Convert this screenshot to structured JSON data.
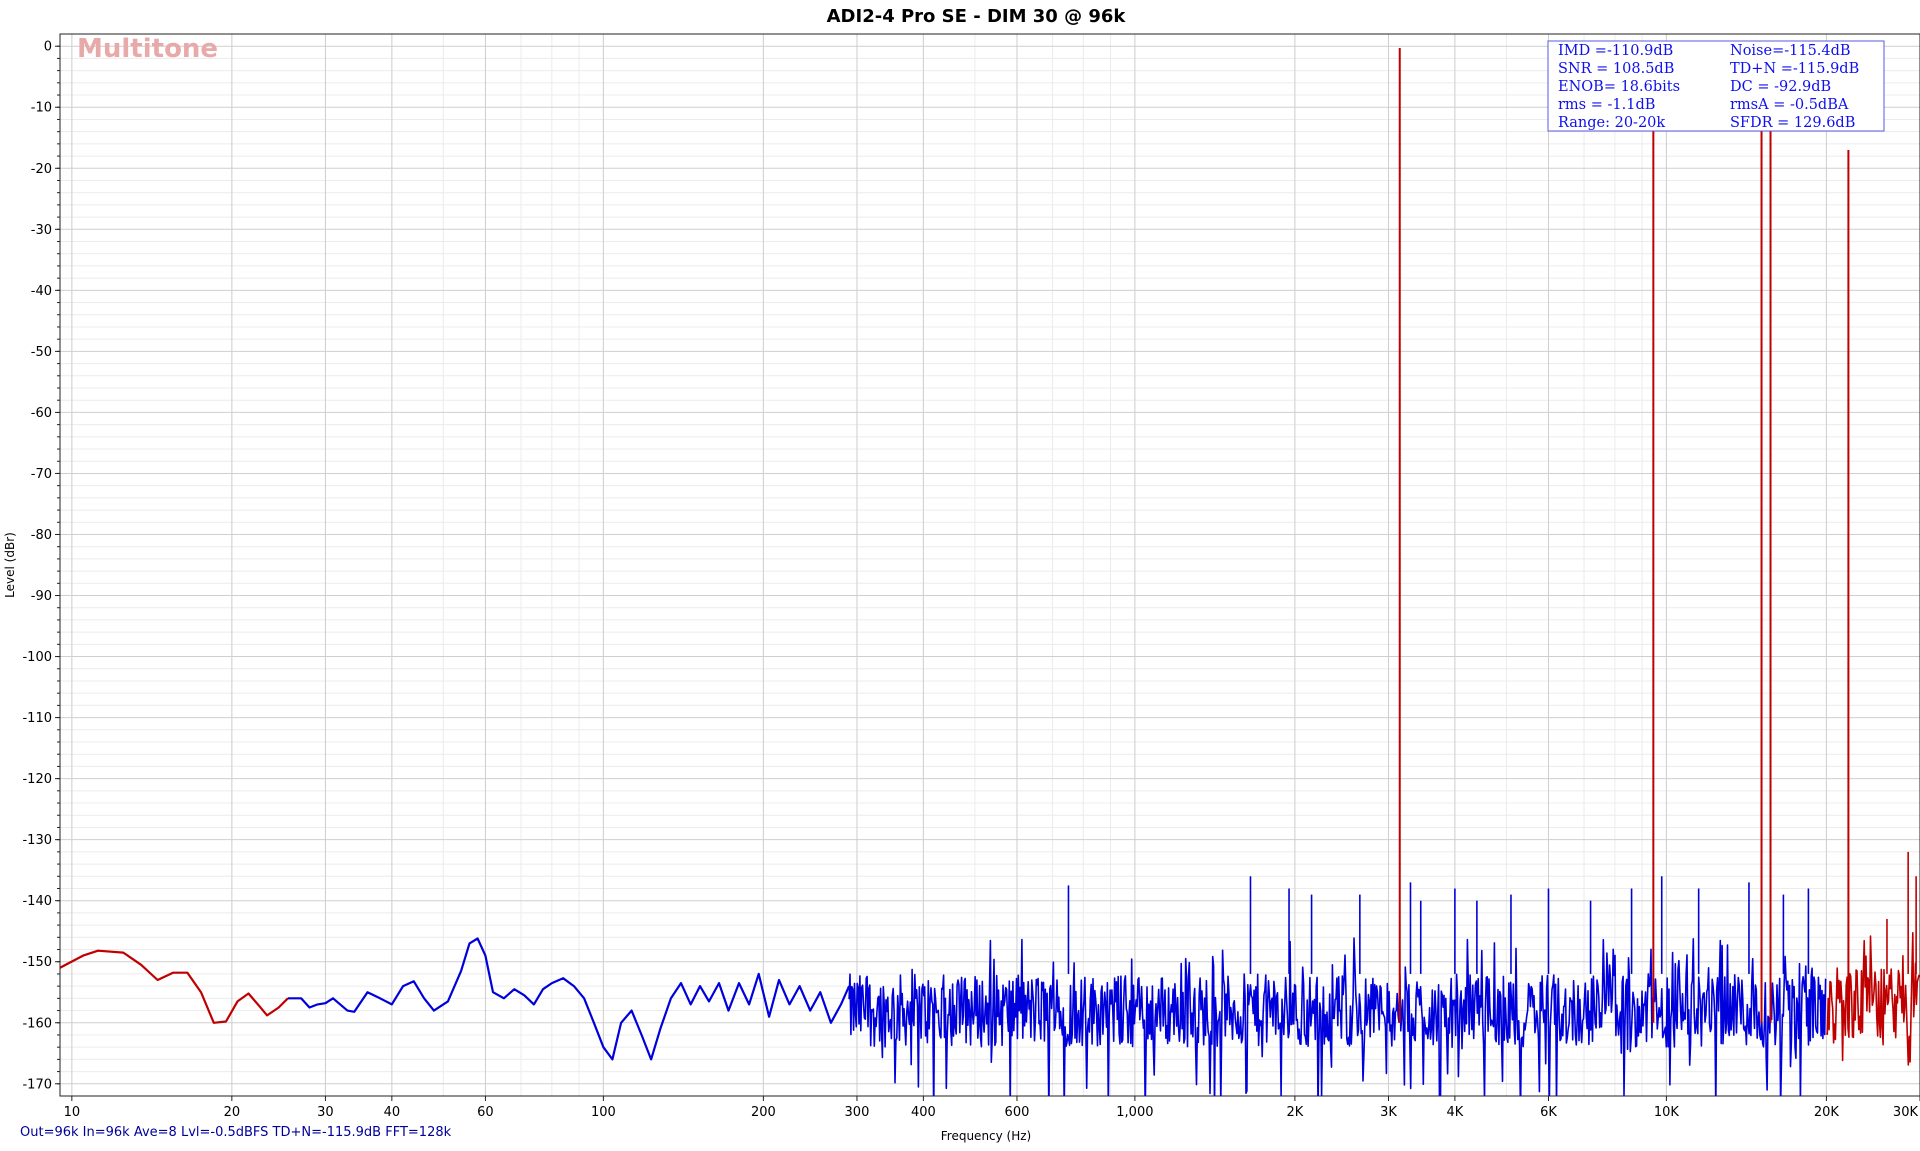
{
  "chart_data": {
    "type": "line",
    "title": "ADI2-4 Pro SE - DIM 30 @ 96k",
    "xlabel": "Frequency (Hz)",
    "ylabel": "Level (dBr)",
    "x_scale": "log",
    "xlim": [
      9.5,
      30000
    ],
    "ylim": [
      -172,
      2
    ],
    "grid": true,
    "x_ticks": [
      {
        "value": 10,
        "label": "10"
      },
      {
        "value": 20,
        "label": "20"
      },
      {
        "value": 30,
        "label": "30"
      },
      {
        "value": 40,
        "label": "40"
      },
      {
        "value": 60,
        "label": "60"
      },
      {
        "value": 100,
        "label": "100"
      },
      {
        "value": 200,
        "label": "200"
      },
      {
        "value": 300,
        "label": "300"
      },
      {
        "value": 400,
        "label": "400"
      },
      {
        "value": 600,
        "label": "600"
      },
      {
        "value": 1000,
        "label": "1,000"
      },
      {
        "value": 2000,
        "label": "2K"
      },
      {
        "value": 3000,
        "label": "3K"
      },
      {
        "value": 4000,
        "label": "4K"
      },
      {
        "value": 6000,
        "label": "6K"
      },
      {
        "value": 10000,
        "label": "10K"
      },
      {
        "value": 20000,
        "label": "20K"
      },
      {
        "value": 30000,
        "label": "30K"
      }
    ],
    "y_ticks": [
      0,
      -10,
      -20,
      -30,
      -40,
      -50,
      -60,
      -70,
      -80,
      -90,
      -100,
      -110,
      -120,
      -130,
      -140,
      -150,
      -160,
      -170
    ],
    "series": [
      {
        "color": "#c00000",
        "description": "low-band noise below 20 Hz",
        "points": [
          [
            9.5,
            -151
          ],
          [
            10.5,
            -149
          ],
          [
            11.2,
            -148.2
          ],
          [
            12.5,
            -148.5
          ],
          [
            13.5,
            -150.5
          ],
          [
            14.5,
            -153
          ],
          [
            15.5,
            -151.8
          ],
          [
            16.5,
            -151.8
          ],
          [
            17.5,
            -155
          ],
          [
            18.5,
            -160
          ],
          [
            19.5,
            -159.8
          ],
          [
            20.5,
            -156.5
          ],
          [
            21.5,
            -155.2
          ],
          [
            22.5,
            -157.2
          ],
          [
            23.3,
            -158.8
          ],
          [
            24.5,
            -157.5
          ],
          [
            25.5,
            -156
          ]
        ]
      },
      {
        "color": "#0000dd",
        "description": "in-band noise floor 20 Hz - 20 kHz",
        "points": [
          [
            25.5,
            -156
          ],
          [
            27,
            -156
          ],
          [
            28,
            -157.5
          ],
          [
            29,
            -157
          ],
          [
            30,
            -156.8
          ],
          [
            31,
            -156
          ],
          [
            33,
            -158
          ],
          [
            34,
            -158.2
          ],
          [
            36,
            -155
          ],
          [
            38,
            -156
          ],
          [
            40,
            -157
          ],
          [
            42,
            -154
          ],
          [
            44,
            -153.2
          ],
          [
            46,
            -156
          ],
          [
            48,
            -158
          ],
          [
            51,
            -156.5
          ],
          [
            54,
            -151.5
          ],
          [
            56,
            -147
          ],
          [
            58,
            -146.2
          ],
          [
            60,
            -149
          ],
          [
            62,
            -155
          ],
          [
            65,
            -156
          ],
          [
            68,
            -154.5
          ],
          [
            71,
            -155.5
          ],
          [
            74,
            -157
          ],
          [
            77,
            -154.5
          ],
          [
            80,
            -153.5
          ],
          [
            84,
            -152.7
          ],
          [
            88,
            -154
          ],
          [
            92,
            -156
          ],
          [
            96,
            -160
          ],
          [
            100,
            -164
          ],
          [
            104,
            -166
          ],
          [
            108,
            -160
          ],
          [
            113,
            -158
          ],
          [
            118,
            -162
          ],
          [
            123,
            -166
          ],
          [
            128,
            -161
          ],
          [
            134,
            -156
          ],
          [
            140,
            -153.5
          ],
          [
            146,
            -157
          ],
          [
            152,
            -154
          ],
          [
            158,
            -156.5
          ],
          [
            165,
            -153.5
          ],
          [
            172,
            -158
          ],
          [
            180,
            -153.5
          ],
          [
            188,
            -157
          ],
          [
            196,
            -152
          ],
          [
            205,
            -159
          ],
          [
            214,
            -153
          ],
          [
            224,
            -157
          ],
          [
            234,
            -154
          ],
          [
            245,
            -158
          ],
          [
            256,
            -155
          ],
          [
            268,
            -160
          ],
          [
            280,
            -157
          ],
          [
            290,
            -154
          ]
        ],
        "noise_band": {
          "from_hz": 290,
          "to_hz": 20000,
          "mean_dB": -158,
          "spread_dB": 6,
          "min_dB": -172.5
        }
      },
      {
        "color": "#c00000",
        "description": "ultrasonic noise above 20 kHz",
        "noise_band": {
          "from_hz": 20000,
          "to_hz": 30000,
          "mean_dB": -157,
          "spread_dB": 6,
          "min_dB": -169
        }
      }
    ],
    "tones": [
      {
        "freq_hz": 3150,
        "level_dB": -0.3,
        "color": "#c00000"
      },
      {
        "freq_hz": 9450,
        "level_dB": -10.5,
        "color": "#c00000"
      },
      {
        "freq_hz": 15100,
        "level_dB": -10.5,
        "color": "#c00000"
      },
      {
        "freq_hz": 15700,
        "level_dB": -12,
        "color": "#c00000"
      },
      {
        "freq_hz": 22000,
        "level_dB": -17,
        "color": "#c00000"
      }
    ],
    "spurs": [
      {
        "freq_hz": 750,
        "level_dB": -137.5
      },
      {
        "freq_hz": 1650,
        "level_dB": -136
      },
      {
        "freq_hz": 1950,
        "level_dB": -138
      },
      {
        "freq_hz": 2150,
        "level_dB": -139
      },
      {
        "freq_hz": 2650,
        "level_dB": -139
      },
      {
        "freq_hz": 3300,
        "level_dB": -137
      },
      {
        "freq_hz": 3450,
        "level_dB": -140
      },
      {
        "freq_hz": 4000,
        "level_dB": -138
      },
      {
        "freq_hz": 4400,
        "level_dB": -140
      },
      {
        "freq_hz": 5100,
        "level_dB": -139
      },
      {
        "freq_hz": 6000,
        "level_dB": -138
      },
      {
        "freq_hz": 7200,
        "level_dB": -140
      },
      {
        "freq_hz": 8600,
        "level_dB": -138
      },
      {
        "freq_hz": 9800,
        "level_dB": -136
      },
      {
        "freq_hz": 11500,
        "level_dB": -138
      },
      {
        "freq_hz": 14300,
        "level_dB": -137
      },
      {
        "freq_hz": 16600,
        "level_dB": -139
      },
      {
        "freq_hz": 18500,
        "level_dB": -138
      },
      {
        "freq_hz": 26000,
        "level_dB": -143
      },
      {
        "freq_hz": 28500,
        "level_dB": -132
      },
      {
        "freq_hz": 29500,
        "level_dB": -136
      }
    ]
  },
  "watermark": "Multitone",
  "stats": {
    "rows": [
      [
        "IMD =-110.9dB",
        "Noise=-115.4dB"
      ],
      [
        "SNR = 108.5dB",
        "TD+N =-115.9dB"
      ],
      [
        "ENOB=  18.6bits",
        "DC   = -92.9dB"
      ],
      [
        "rms =  -1.1dB",
        "rmsA =  -0.5dBA"
      ],
      [
        "Range: 20-20k",
        "SFDR = 129.6dB"
      ]
    ]
  },
  "footer": "Out=96k In=96k Ave=8 Lvl=-0.5dBFS TD+N=-115.9dB FFT=128k",
  "colors": {
    "in_band": "#0000dd",
    "out_band": "#c00000",
    "stats_text": "#1010ee",
    "stats_border": "#5a5ae0",
    "grid": "#cfcfcf",
    "grid_minor": "#ececec"
  }
}
